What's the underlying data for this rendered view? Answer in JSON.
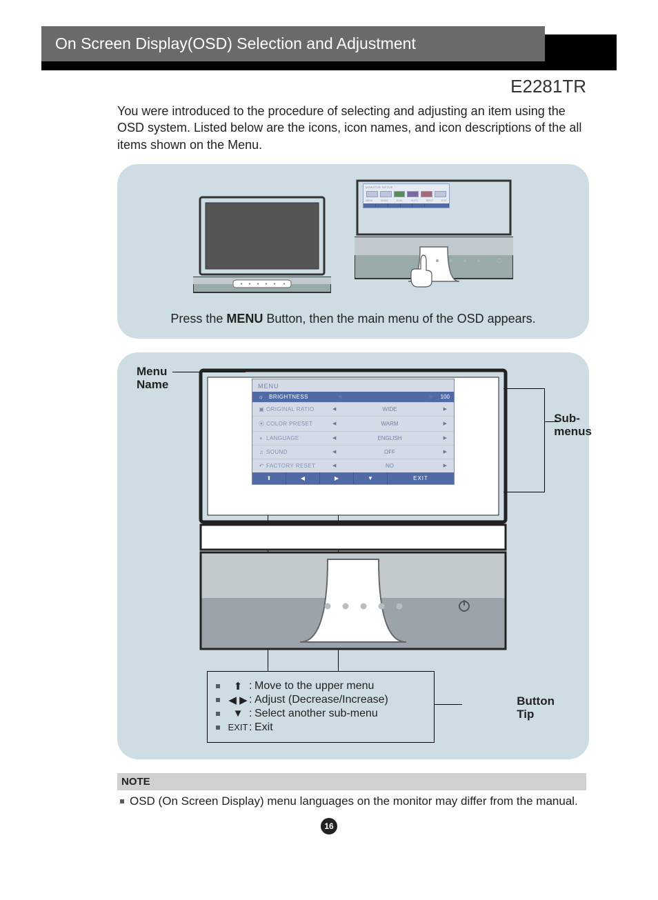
{
  "header": {
    "title": "On Screen Display(OSD) Selection and Adjustment"
  },
  "model": "E2281TR",
  "intro": "You were introduced to the procedure of selecting and adjusting an item using the OSD system. Listed below are the icons, icon names, and icon descriptions of the all items shown on the Menu.",
  "panel1": {
    "caption_pre": "Press the ",
    "caption_bold": "MENU",
    "caption_post": " Button, then the main menu of the OSD appears.",
    "mini_osd": {
      "title": "MONITOR SETUP",
      "labels": [
        "MENU",
        "MODE",
        "DUAL",
        "AUTO",
        "INPUT",
        "EXIT"
      ]
    }
  },
  "panel2": {
    "labels": {
      "menu_name": "Menu\nName",
      "sub_menus": "Sub-\nmenus",
      "button_tip": "Button\nTip"
    },
    "osd": {
      "title": "MENU",
      "brightness": {
        "label": "BRIGHTNESS",
        "value": "100"
      },
      "rows": [
        {
          "icon": "▣",
          "label": "ORIGINAL RATIO",
          "value": "WIDE"
        },
        {
          "icon": "⦿",
          "label": "COLOR PRESET",
          "value": "WARM"
        },
        {
          "icon": "◐",
          "label": "LANGUAGE",
          "value": "ENGLISH"
        },
        {
          "icon": "♫",
          "label": "SOUND",
          "value": "OFF"
        },
        {
          "icon": "↶",
          "label": "FACTORY RESET",
          "value": "NO"
        }
      ],
      "nav": {
        "up": "⬆",
        "left": "◀",
        "right": "▶",
        "down": "▼",
        "exit": "EXIT"
      }
    },
    "tips": [
      {
        "icon": "⬆",
        "text": "Move to the upper menu"
      },
      {
        "icon": "◀ ▶",
        "text": "Adjust (Decrease/Increase)"
      },
      {
        "icon": "▼",
        "text": "Select another sub-menu"
      },
      {
        "icon": "EXIT",
        "text": "Exit"
      }
    ]
  },
  "note": {
    "title": "NOTE",
    "body": "OSD (On Screen Display) menu languages on the monitor may differ from the manual."
  },
  "page_number": "16"
}
